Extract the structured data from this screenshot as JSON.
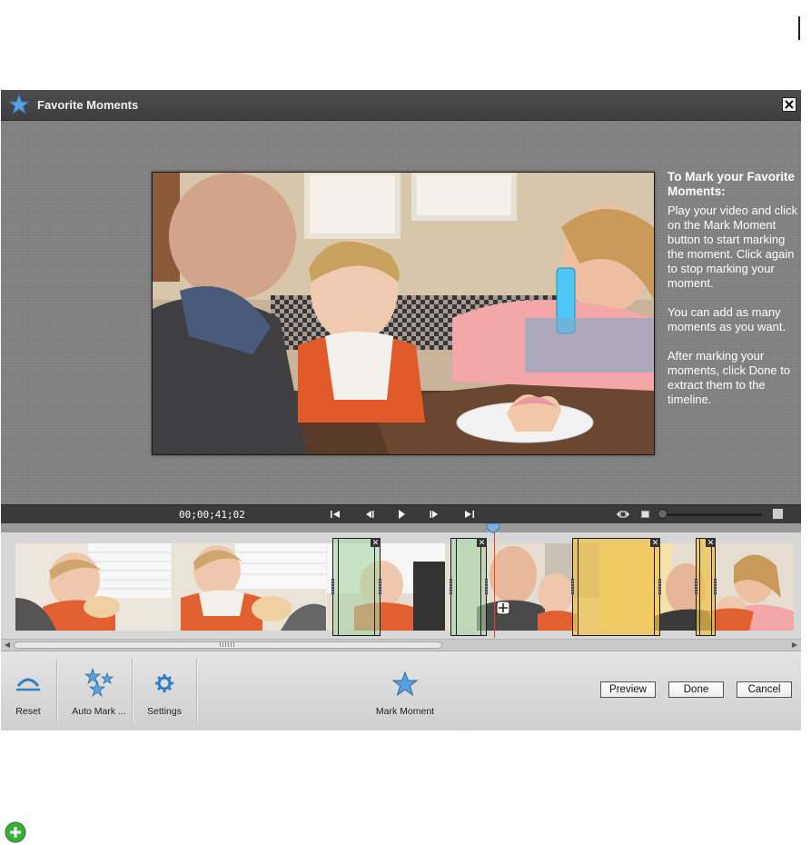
{
  "window": {
    "title": "Favorite Moments",
    "close_label": "✕"
  },
  "instructions": {
    "heading": "To Mark your Favorite Moments:",
    "paragraphs": [
      "Play your video and click on the Mark Moment button to start marking the moment. Click again to stop marking your moment.",
      "You can add as many moments as you want.",
      "After marking your moments, click Done to extract them to the timeline."
    ]
  },
  "transport": {
    "timecode": "00;00;41;02",
    "buttons": [
      "go-to-start",
      "step-back",
      "play",
      "step-forward",
      "go-to-end"
    ]
  },
  "timeline": {
    "moments": [
      {
        "color": "green",
        "close": "✕"
      },
      {
        "color": "green",
        "close": "✕"
      },
      {
        "color": "yellow",
        "close": "✕"
      },
      {
        "color": "yellow",
        "close": "✕"
      }
    ]
  },
  "toolbar": {
    "reset_label": "Reset",
    "auto_mark_label": "Auto Mark ...",
    "settings_label": "Settings",
    "mark_moment_label": "Mark Moment",
    "preview_label": "Preview",
    "done_label": "Done",
    "cancel_label": "Cancel"
  },
  "colors": {
    "accent_star": "#4a90c8",
    "moment_green": "#a9d6a8",
    "moment_yellow": "#f0c24a",
    "playhead": "#e8422b"
  }
}
